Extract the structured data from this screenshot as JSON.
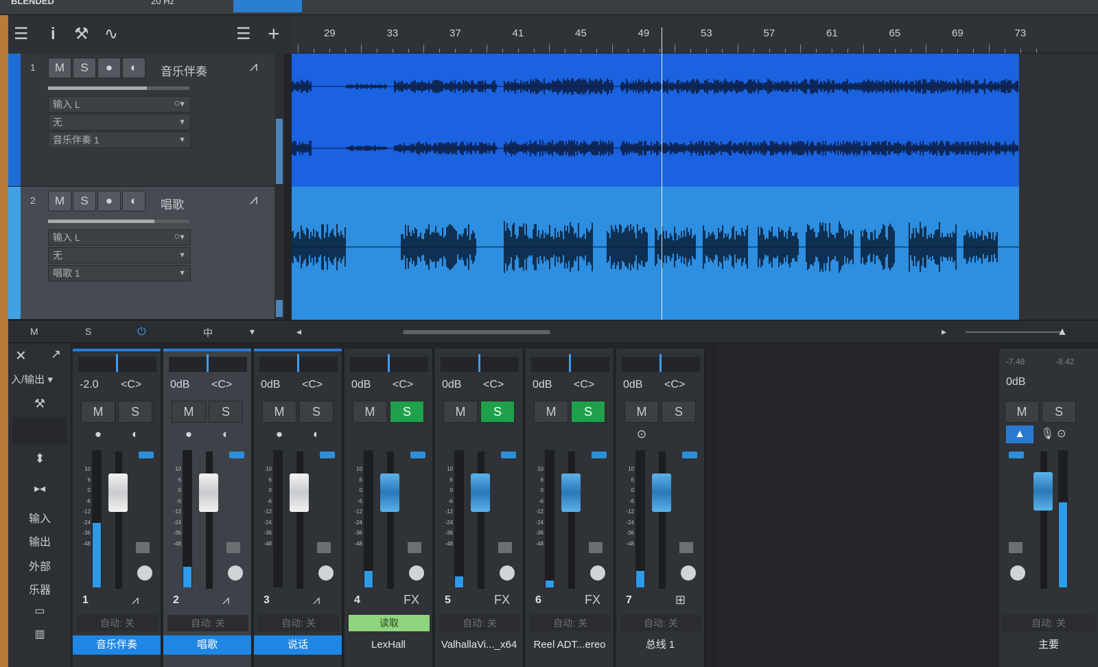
{
  "window": {
    "title": "BLENDED",
    "rate": "20 Hz"
  },
  "toolbar": {
    "icons": [
      "menu-icon",
      "info-icon",
      "wrench-icon",
      "curve-icon",
      "list-icon",
      "add-icon"
    ],
    "glyphs": {
      "menu": "☰",
      "info": "i",
      "wrench": "⚒",
      "curve": "∿",
      "list": "☰",
      "add": "+"
    }
  },
  "ruler": {
    "bars": [
      "29",
      "33",
      "37",
      "41",
      "45",
      "49",
      "53",
      "57",
      "61",
      "65",
      "69",
      "73"
    ]
  },
  "tracks": [
    {
      "number": "1",
      "mute": "M",
      "solo": "S",
      "rec": "●",
      "monitor": "◐",
      "name": "音乐伴奏",
      "input": "输入 L",
      "insert": "无",
      "output": "音乐伴奏 1",
      "color": "#1a6ed6",
      "volume": 0.7
    },
    {
      "number": "2",
      "mute": "M",
      "solo": "S",
      "rec": "●",
      "monitor": "◐",
      "name": "唱歌",
      "input": "输入 L",
      "insert": "无",
      "output": "唱歌 1",
      "color": "#3ea2e4",
      "volume": 0.75
    }
  ],
  "bottombar": {
    "mute": "M",
    "solo": "S",
    "power": "⏻",
    "mid": "中",
    "arrow": "▾"
  },
  "mixer_left": {
    "close": "✕",
    "expand": "↗",
    "io": "入/输出",
    "io_arrow": "▾",
    "wrench": "⚒",
    "items": [
      "输入",
      "输出",
      "外部",
      "乐器"
    ]
  },
  "strips": [
    {
      "number": "1",
      "vol": "-2.0",
      "pan": "<C>",
      "mute": "M",
      "solo": "S",
      "solo_on": false,
      "type": "⩘",
      "auto": "自动: 关",
      "auto_on": false,
      "name": "音乐伴奏",
      "name_blue": true,
      "fader": "white",
      "level": 0.47,
      "selected": false
    },
    {
      "number": "2",
      "vol": "0dB",
      "pan": "<C>",
      "mute": "M",
      "solo": "S",
      "solo_on": false,
      "type": "⩘",
      "auto": "自动: 关",
      "auto_on": false,
      "name": "唱歌",
      "name_blue": true,
      "fader": "white",
      "level": 0.15,
      "selected": true
    },
    {
      "number": "3",
      "vol": "0dB",
      "pan": "<C>",
      "mute": "M",
      "solo": "S",
      "solo_on": false,
      "type": "⩘",
      "auto": "自动: 关",
      "auto_on": false,
      "name": "说话",
      "name_blue": true,
      "fader": "white",
      "level": 0,
      "selected": false
    },
    {
      "number": "4",
      "vol": "0dB",
      "pan": "<C>",
      "mute": "M",
      "solo": "S",
      "solo_on": true,
      "type": "FX",
      "auto": "读取",
      "auto_on": true,
      "name": "LexHall",
      "name_blue": false,
      "fader": "blue",
      "level": 0.12,
      "selected": false
    },
    {
      "number": "5",
      "vol": "0dB",
      "pan": "<C>",
      "mute": "M",
      "solo": "S",
      "solo_on": true,
      "type": "FX",
      "auto": "自动: 关",
      "auto_on": false,
      "name": "ValhallaVi..._x64",
      "name_blue": false,
      "fader": "blue",
      "level": 0.08,
      "selected": false
    },
    {
      "number": "6",
      "vol": "0dB",
      "pan": "<C>",
      "mute": "M",
      "solo": "S",
      "solo_on": true,
      "type": "FX",
      "auto": "自动: 关",
      "auto_on": false,
      "name": "Reel ADT...ereo",
      "name_blue": false,
      "fader": "blue",
      "level": 0.05,
      "selected": false
    },
    {
      "number": "7",
      "vol": "0dB",
      "pan": "<C>",
      "mute": "M",
      "solo": "S",
      "solo_on": false,
      "type": "⊞",
      "auto": "自动: 关",
      "auto_on": false,
      "name": "总线 1",
      "name_blue": false,
      "fader": "blue",
      "level": 0.12,
      "selected": false
    }
  ],
  "scale_labels": [
    "10",
    "6",
    "0",
    "-6",
    "-12",
    "-24",
    "-36",
    "-48"
  ],
  "main": {
    "peak_l": "-7.48",
    "peak_r": "-8.42",
    "vol": "0dB",
    "mute": "M",
    "solo": "S",
    "auto": "自动: 关",
    "name": "主要",
    "level": 0.62
  }
}
